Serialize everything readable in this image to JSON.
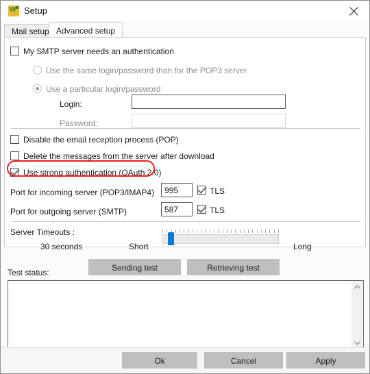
{
  "window": {
    "title": "Setup",
    "app_icon": "word-mail-icon",
    "close_icon": "close-icon"
  },
  "tabs": [
    {
      "label": "Mail setup",
      "active": false
    },
    {
      "label": "Advanced setup",
      "active": true
    }
  ],
  "auth": {
    "smtp_auth_label": "My SMTP server needs an authentication",
    "smtp_auth_checked": false,
    "radio_same_label": "Use the same login/password than for the POP3 server",
    "radio_same_selected": false,
    "radio_particular_label": "Use a particular login/password",
    "radio_particular_selected": true,
    "login_label": "Login:",
    "login_value": "",
    "password_label": "Password:",
    "password_value": ""
  },
  "options": [
    {
      "label": "Disable the email reception process (POP)",
      "checked": false
    },
    {
      "label": "Delete the messages from the server after download",
      "checked": false
    },
    {
      "label": "Use strong authentication (OAuth 2.0)",
      "checked": true,
      "highlighted": true
    }
  ],
  "ports": {
    "incoming_label": "Port for incoming server (POP3/IMAP4)",
    "incoming_value": "995",
    "incoming_tls_label": "TLS",
    "incoming_tls_checked": true,
    "outgoing_label": "Port for outgoing server (SMTP)",
    "outgoing_value": "587",
    "outgoing_tls_label": "TLS",
    "outgoing_tls_checked": true
  },
  "timeouts": {
    "title": "Server Timeouts :",
    "value_label": "30 seconds",
    "short_label": "Short",
    "long_label": "Long",
    "slider_position_percent": 5,
    "tick_count": 28
  },
  "tests": {
    "sending_label": "Sending test",
    "retrieving_label": "Retrieving test",
    "status_label": "Test status:",
    "status_text": ""
  },
  "footer": {
    "ok_label": "Ok",
    "cancel_label": "Cancel",
    "apply_label": "Apply"
  },
  "colors": {
    "accent_blue": "#0a7bd4",
    "annotation_red": "#ee1c1c",
    "button_gray": "#bfbfbf",
    "icon_gold": "#e8b93a",
    "icon_green": "#3f7d33"
  }
}
